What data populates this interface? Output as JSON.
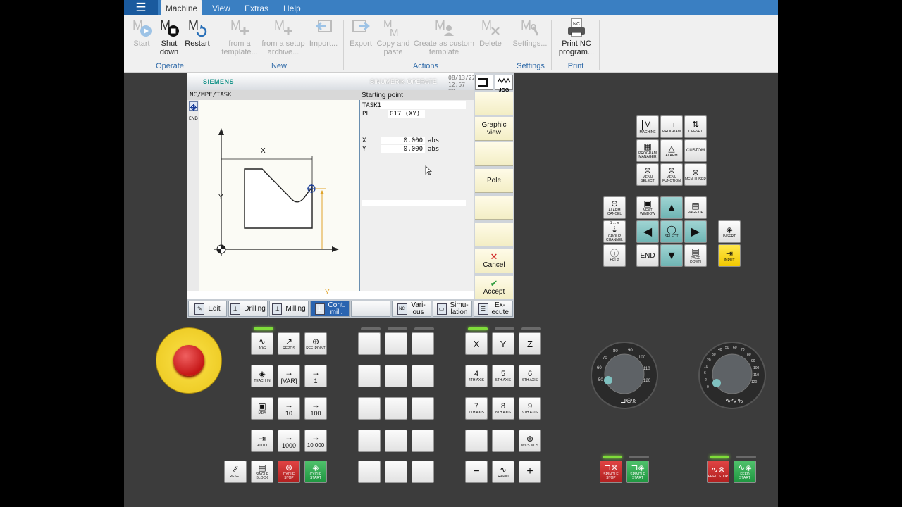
{
  "menu": {
    "tabs": [
      "Machine",
      "View",
      "Extras",
      "Help"
    ],
    "active_tab": "Machine"
  },
  "ribbon": {
    "groups": {
      "operate": "Operate",
      "new": "New",
      "actions": "Actions",
      "settings": "Settings",
      "print": "Print"
    },
    "buttons": {
      "start": "Start",
      "shutdown": "Shut down",
      "restart": "Restart",
      "from_template": "from a template...",
      "from_setup": "from a setup archive...",
      "import": "Import...",
      "export": "Export",
      "copy_paste": "Copy and paste",
      "custom_template": "Create as custom template",
      "delete": "Delete",
      "settings": "Settings...",
      "print_nc": "Print NC program..."
    }
  },
  "hmi": {
    "brand": "SIEMENS",
    "product": "SINUMERIK OPERATE",
    "date": "08/13/22",
    "time": "12:57 PM",
    "jog_label": "JOG",
    "path": "NC/MPF/TASK",
    "end_label": "END",
    "panel_title": "Starting point",
    "params": {
      "name": "TASK1",
      "pl_label": "PL",
      "pl_value": "G17 (XY)",
      "x_label": "X",
      "x_value": "0.000",
      "x_unit": "abs",
      "y_label": "Y",
      "y_value": "0.000",
      "y_unit": "abs"
    },
    "drawing": {
      "axis_y": "Y",
      "axis_x": "X",
      "dim_x": "X",
      "dim_y": "Y"
    },
    "softkeys": {
      "graphic_view": "Graphic view",
      "pole": "Pole",
      "cancel": "Cancel",
      "accept": "Accept"
    },
    "bottom_keys": {
      "edit": "Edit",
      "drilling": "Drilling",
      "milling": "Milling",
      "cont_mill": "Cont. mill.",
      "various": "Vari- ous",
      "simulation": "Simu- lation",
      "execute": "Ex- ecute",
      "nc_icon": "NC"
    }
  },
  "keyboard": {
    "modes": {
      "jog": "JOG",
      "repos": "REPOS",
      "ref_point": "REF. POINT",
      "teach_in": "TEACH IN",
      "var": "[VAR]",
      "inc_1": "1",
      "mda": "MDA",
      "inc_10": "10",
      "inc_100": "100",
      "auto": "AUTO",
      "inc_1000": "1000",
      "inc_10000": "10 000",
      "reset": "RESET",
      "single_block": "SINGLE BLOCK",
      "cycle_stop": "CYCLE STOP",
      "cycle_start": "CYCLE START"
    },
    "axes": {
      "x": "X",
      "y": "Y",
      "z": "Z",
      "a4": "4",
      "a4_label": "4TH AXIS",
      "a5": "5",
      "a5_label": "5TH AXIS",
      "a6": "6",
      "a6_label": "6TH AXIS",
      "a7": "7",
      "a7_label": "7TH AXIS",
      "a8": "8",
      "a8_label": "8TH AXIS",
      "a9": "9",
      "a9_label": "9TH AXIS",
      "wcs_mcs": "WCS MCS",
      "minus": "−",
      "rapid": "RAPID",
      "plus": "+"
    },
    "nav": {
      "machine": "MACHINE",
      "program": "PROGRAM",
      "offset": "OFFSET",
      "program_manager": "PROGRAM MANAGER",
      "alarm": "ALARM",
      "custom": "CUSTOM",
      "menu_select": "MENU SELECT",
      "menu_function": "MENU FUNCTION",
      "menu_user": "MENU USER",
      "alarm_cancel": "ALARM CANCEL",
      "next_window": "NEXT WINDOW",
      "page_up": "PAGE UP",
      "group_channel": "GROUP CHANNEL",
      "group_top": "1 ... n",
      "select": "SELECT",
      "insert": "INSERT",
      "help": "HELP",
      "end": "END",
      "page_down": "PAGE DOWN",
      "input": "INPUT"
    },
    "spindle": {
      "stop": "SPINDLE STOP",
      "start": "SPINDLE START",
      "pct": "%"
    },
    "feed": {
      "stop": "FEED STOP",
      "start": "FEED START",
      "pct": "%"
    },
    "dial_left_ticks": [
      "50",
      "60",
      "70",
      "80",
      "90",
      "100",
      "110",
      "120"
    ],
    "dial_right_ticks": [
      "0",
      "2",
      "6",
      "10",
      "20",
      "30",
      "40",
      "50",
      "60",
      "70",
      "80",
      "90",
      "100",
      "110",
      "120"
    ]
  },
  "colors": {
    "blue": "#3a7fc2",
    "teal": "#7fc1c0",
    "red": "#cc2b2b",
    "green": "#2fa84f",
    "yellow": "#f5d10a"
  }
}
